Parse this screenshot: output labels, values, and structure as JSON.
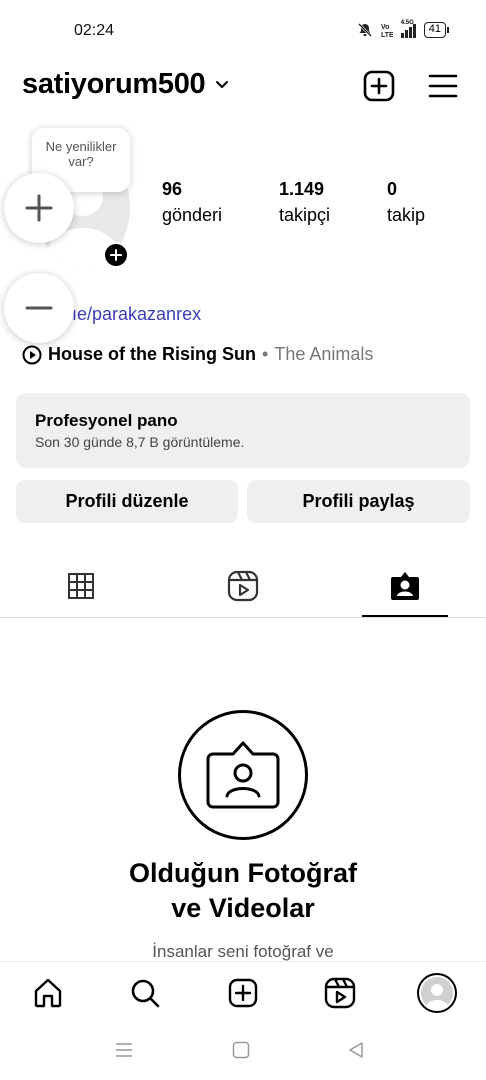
{
  "status_bar": {
    "time": "02:24",
    "battery": "41",
    "network": "4.5G"
  },
  "header": {
    "username": "satiyorum500"
  },
  "note": {
    "text": "Ne yenilikler var?"
  },
  "stats": [
    {
      "value": "96",
      "label": "gönderi"
    },
    {
      "value": "1.149",
      "label": "takipçi"
    },
    {
      "value": "0",
      "label": "takip"
    }
  ],
  "bio": {
    "link": "ıe/parakazanrex"
  },
  "music": {
    "song": "House of the Rising Sun",
    "separator": "•",
    "artist": "The Animals"
  },
  "dashboard": {
    "title": "Profesyonel pano",
    "subtitle": "Son 30 günde 8,7 B görüntüleme."
  },
  "buttons": {
    "edit_profile": "Profili düzenle",
    "share_profile": "Profili paylaş"
  },
  "tabs": [
    "grid",
    "reels",
    "tagged"
  ],
  "tabs_active": "tagged",
  "empty_state": {
    "title_line1": "Olduğun Fotoğraf",
    "title_line2": "ve Videolar",
    "subtitle": "İnsanlar seni fotoğraf ve"
  },
  "bottom_nav": [
    "home",
    "search",
    "create",
    "reels",
    "profile"
  ],
  "icons": {
    "dropdown": "chevron-down-icon",
    "create": "plus-square-icon",
    "menu": "hamburger-menu-icon",
    "zoom_in": "plus-icon",
    "zoom_out": "minus-icon"
  },
  "colors": {
    "link": "#3a3fb5",
    "button_bg": "#efefef",
    "muted": "#777777"
  }
}
